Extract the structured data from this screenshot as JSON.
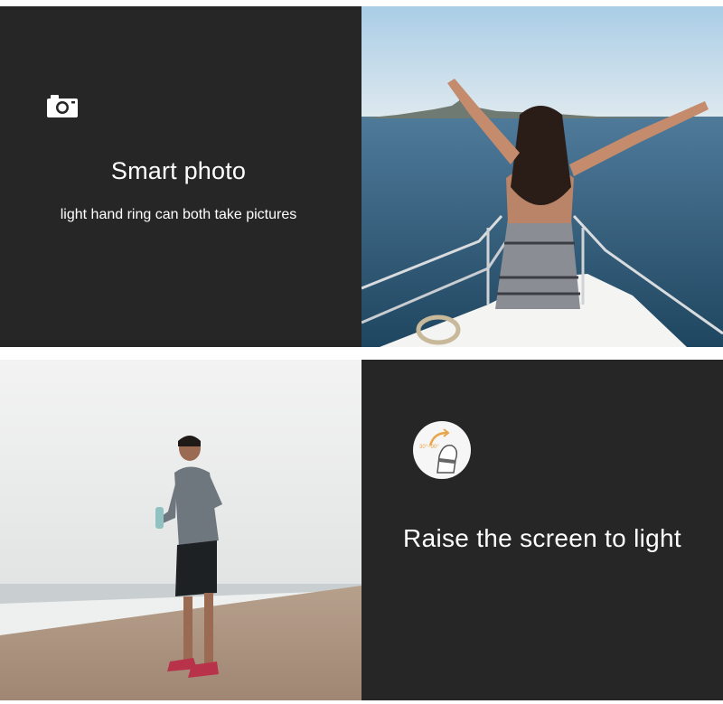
{
  "panels": {
    "smart_photo": {
      "title": "Smart photo",
      "subtitle": "light hand ring can both take pictures",
      "icon": "camera-icon"
    },
    "boat_photo": {
      "kind": "photo",
      "subject": "woman on boat bow with raised arms"
    },
    "beach_photo": {
      "kind": "photo",
      "subject": "man checking wristband on beach"
    },
    "raise_screen": {
      "title": "Raise the screen to light",
      "icon": "wrist-raise-icon",
      "icon_text": "30°~90°"
    }
  },
  "colors": {
    "panel_bg": "#262626",
    "text": "#ffffff",
    "icon_accent": "#e8a54a"
  }
}
